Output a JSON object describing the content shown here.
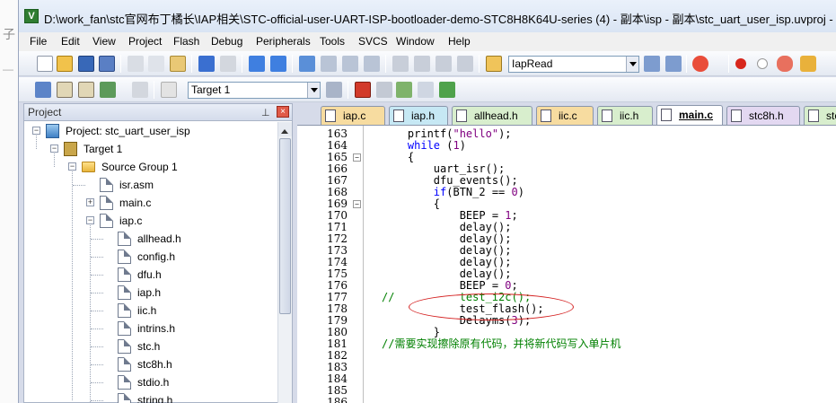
{
  "window": {
    "title": "D:\\work_fan\\stc官网布丁橘长\\IAP相关\\STC-official-user-UART-ISP-bootloader-demo-STC8H8K64U-series (4) - 副本\\isp - 副本\\stc_uart_user_isp.uvproj - µV",
    "app_icon": "V"
  },
  "menu": [
    "File",
    "Edit",
    "View",
    "Project",
    "Flash",
    "Debug",
    "Peripherals",
    "Tools",
    "SVCS",
    "Window",
    "Help"
  ],
  "toolbar": {
    "find_combo": "IapRead",
    "target_combo": "Target 1"
  },
  "project_panel": {
    "title": "Project",
    "pin": "ᵖ",
    "close": "×",
    "tree": [
      {
        "label": "Project: stc_uart_user_isp",
        "icon": "project-icon",
        "expander": "−"
      },
      {
        "label": "Target 1",
        "icon": "target-icon",
        "expander": "−"
      },
      {
        "label": "Source Group 1",
        "icon": "folder-icon",
        "expander": "−"
      },
      {
        "label": "isr.asm",
        "icon": "file-icon"
      },
      {
        "label": "main.c",
        "icon": "file-icon",
        "expander": "+"
      },
      {
        "label": "iap.c",
        "icon": "file-icon",
        "expander": "−"
      },
      {
        "label": "allhead.h",
        "icon": "file-icon"
      },
      {
        "label": "config.h",
        "icon": "file-icon"
      },
      {
        "label": "dfu.h",
        "icon": "file-icon"
      },
      {
        "label": "iap.h",
        "icon": "file-icon"
      },
      {
        "label": "iic.h",
        "icon": "file-icon"
      },
      {
        "label": "intrins.h",
        "icon": "file-icon"
      },
      {
        "label": "stc.h",
        "icon": "file-icon"
      },
      {
        "label": "stc8h.h",
        "icon": "file-icon"
      },
      {
        "label": "stdio.h",
        "icon": "file-icon"
      },
      {
        "label": "string.h",
        "icon": "file-icon"
      }
    ]
  },
  "tabs": [
    {
      "label": "iap.c",
      "color": "#f7dca0"
    },
    {
      "label": "iap.h",
      "color": "#c6e8f4"
    },
    {
      "label": "allhead.h",
      "color": "#d8eecd"
    },
    {
      "label": "iic.c",
      "color": "#f7dca0"
    },
    {
      "label": "iic.h",
      "color": "#d8eecd"
    },
    {
      "label": "main.c",
      "color": "#ffffff",
      "active": true
    },
    {
      "label": "stc8h.h",
      "color": "#e3d8f1"
    },
    {
      "label": "stc.h",
      "color": "#d8eecd"
    },
    {
      "label": "",
      "color": "#f7dca0"
    }
  ],
  "code_lines": [
    {
      "num": "163",
      "text": "    printf(\"hello\");"
    },
    {
      "num": "164",
      "text": "    while (1)"
    },
    {
      "num": "165",
      "text": "    {",
      "fold": "−"
    },
    {
      "num": "166",
      "text": "        uart_isr();"
    },
    {
      "num": "167",
      "text": "        dfu_events();"
    },
    {
      "num": "168",
      "text": "        if(BTN_2 == 0)"
    },
    {
      "num": "169",
      "text": "        {",
      "fold": "−"
    },
    {
      "num": "170",
      "text": "            BEEP = 1;"
    },
    {
      "num": "171",
      "text": "            delay();"
    },
    {
      "num": "172",
      "text": "            delay();"
    },
    {
      "num": "173",
      "text": "            delay();"
    },
    {
      "num": "174",
      "text": "            delay();"
    },
    {
      "num": "175",
      "text": "            delay();"
    },
    {
      "num": "176",
      "text": "            BEEP = 0;"
    },
    {
      "num": "177",
      "text": "//          test_i2c();"
    },
    {
      "num": "178",
      "text": "            test_flash();"
    },
    {
      "num": "179",
      "text": "            Delayms(3);"
    },
    {
      "num": "180",
      "text": "        }"
    },
    {
      "num": "181",
      "text": "//需要实现擦除原有代码，并将新代码写入单片机"
    },
    {
      "num": "182",
      "text": ""
    },
    {
      "num": "183",
      "text": ""
    },
    {
      "num": "184",
      "text": ""
    },
    {
      "num": "185",
      "text": ""
    },
    {
      "num": "186",
      "text": ""
    }
  ],
  "colors": {
    "keyword": "#0000ff",
    "string": "#800080",
    "comment": "#008000",
    "annotation_circle": "#d42020"
  }
}
